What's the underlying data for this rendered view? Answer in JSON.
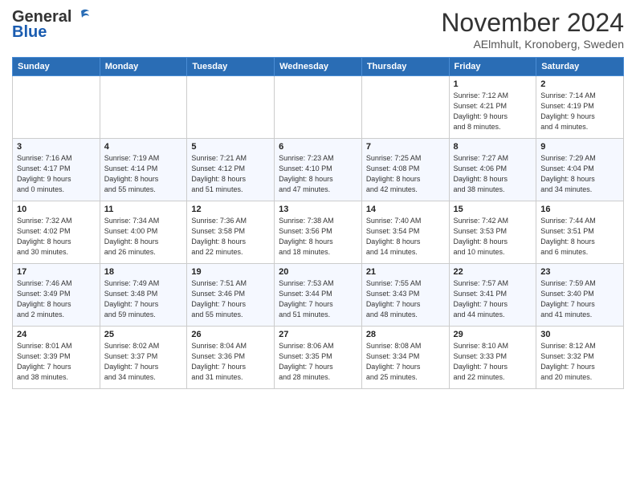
{
  "header": {
    "logo_line1": "General",
    "logo_line2": "Blue",
    "month": "November 2024",
    "location": "AElmhult, Kronoberg, Sweden"
  },
  "weekdays": [
    "Sunday",
    "Monday",
    "Tuesday",
    "Wednesday",
    "Thursday",
    "Friday",
    "Saturday"
  ],
  "weeks": [
    [
      {
        "day": "",
        "info": ""
      },
      {
        "day": "",
        "info": ""
      },
      {
        "day": "",
        "info": ""
      },
      {
        "day": "",
        "info": ""
      },
      {
        "day": "",
        "info": ""
      },
      {
        "day": "1",
        "info": "Sunrise: 7:12 AM\nSunset: 4:21 PM\nDaylight: 9 hours\nand 8 minutes."
      },
      {
        "day": "2",
        "info": "Sunrise: 7:14 AM\nSunset: 4:19 PM\nDaylight: 9 hours\nand 4 minutes."
      }
    ],
    [
      {
        "day": "3",
        "info": "Sunrise: 7:16 AM\nSunset: 4:17 PM\nDaylight: 9 hours\nand 0 minutes."
      },
      {
        "day": "4",
        "info": "Sunrise: 7:19 AM\nSunset: 4:14 PM\nDaylight: 8 hours\nand 55 minutes."
      },
      {
        "day": "5",
        "info": "Sunrise: 7:21 AM\nSunset: 4:12 PM\nDaylight: 8 hours\nand 51 minutes."
      },
      {
        "day": "6",
        "info": "Sunrise: 7:23 AM\nSunset: 4:10 PM\nDaylight: 8 hours\nand 47 minutes."
      },
      {
        "day": "7",
        "info": "Sunrise: 7:25 AM\nSunset: 4:08 PM\nDaylight: 8 hours\nand 42 minutes."
      },
      {
        "day": "8",
        "info": "Sunrise: 7:27 AM\nSunset: 4:06 PM\nDaylight: 8 hours\nand 38 minutes."
      },
      {
        "day": "9",
        "info": "Sunrise: 7:29 AM\nSunset: 4:04 PM\nDaylight: 8 hours\nand 34 minutes."
      }
    ],
    [
      {
        "day": "10",
        "info": "Sunrise: 7:32 AM\nSunset: 4:02 PM\nDaylight: 8 hours\nand 30 minutes."
      },
      {
        "day": "11",
        "info": "Sunrise: 7:34 AM\nSunset: 4:00 PM\nDaylight: 8 hours\nand 26 minutes."
      },
      {
        "day": "12",
        "info": "Sunrise: 7:36 AM\nSunset: 3:58 PM\nDaylight: 8 hours\nand 22 minutes."
      },
      {
        "day": "13",
        "info": "Sunrise: 7:38 AM\nSunset: 3:56 PM\nDaylight: 8 hours\nand 18 minutes."
      },
      {
        "day": "14",
        "info": "Sunrise: 7:40 AM\nSunset: 3:54 PM\nDaylight: 8 hours\nand 14 minutes."
      },
      {
        "day": "15",
        "info": "Sunrise: 7:42 AM\nSunset: 3:53 PM\nDaylight: 8 hours\nand 10 minutes."
      },
      {
        "day": "16",
        "info": "Sunrise: 7:44 AM\nSunset: 3:51 PM\nDaylight: 8 hours\nand 6 minutes."
      }
    ],
    [
      {
        "day": "17",
        "info": "Sunrise: 7:46 AM\nSunset: 3:49 PM\nDaylight: 8 hours\nand 2 minutes."
      },
      {
        "day": "18",
        "info": "Sunrise: 7:49 AM\nSunset: 3:48 PM\nDaylight: 7 hours\nand 59 minutes."
      },
      {
        "day": "19",
        "info": "Sunrise: 7:51 AM\nSunset: 3:46 PM\nDaylight: 7 hours\nand 55 minutes."
      },
      {
        "day": "20",
        "info": "Sunrise: 7:53 AM\nSunset: 3:44 PM\nDaylight: 7 hours\nand 51 minutes."
      },
      {
        "day": "21",
        "info": "Sunrise: 7:55 AM\nSunset: 3:43 PM\nDaylight: 7 hours\nand 48 minutes."
      },
      {
        "day": "22",
        "info": "Sunrise: 7:57 AM\nSunset: 3:41 PM\nDaylight: 7 hours\nand 44 minutes."
      },
      {
        "day": "23",
        "info": "Sunrise: 7:59 AM\nSunset: 3:40 PM\nDaylight: 7 hours\nand 41 minutes."
      }
    ],
    [
      {
        "day": "24",
        "info": "Sunrise: 8:01 AM\nSunset: 3:39 PM\nDaylight: 7 hours\nand 38 minutes."
      },
      {
        "day": "25",
        "info": "Sunrise: 8:02 AM\nSunset: 3:37 PM\nDaylight: 7 hours\nand 34 minutes."
      },
      {
        "day": "26",
        "info": "Sunrise: 8:04 AM\nSunset: 3:36 PM\nDaylight: 7 hours\nand 31 minutes."
      },
      {
        "day": "27",
        "info": "Sunrise: 8:06 AM\nSunset: 3:35 PM\nDaylight: 7 hours\nand 28 minutes."
      },
      {
        "day": "28",
        "info": "Sunrise: 8:08 AM\nSunset: 3:34 PM\nDaylight: 7 hours\nand 25 minutes."
      },
      {
        "day": "29",
        "info": "Sunrise: 8:10 AM\nSunset: 3:33 PM\nDaylight: 7 hours\nand 22 minutes."
      },
      {
        "day": "30",
        "info": "Sunrise: 8:12 AM\nSunset: 3:32 PM\nDaylight: 7 hours\nand 20 minutes."
      }
    ]
  ]
}
